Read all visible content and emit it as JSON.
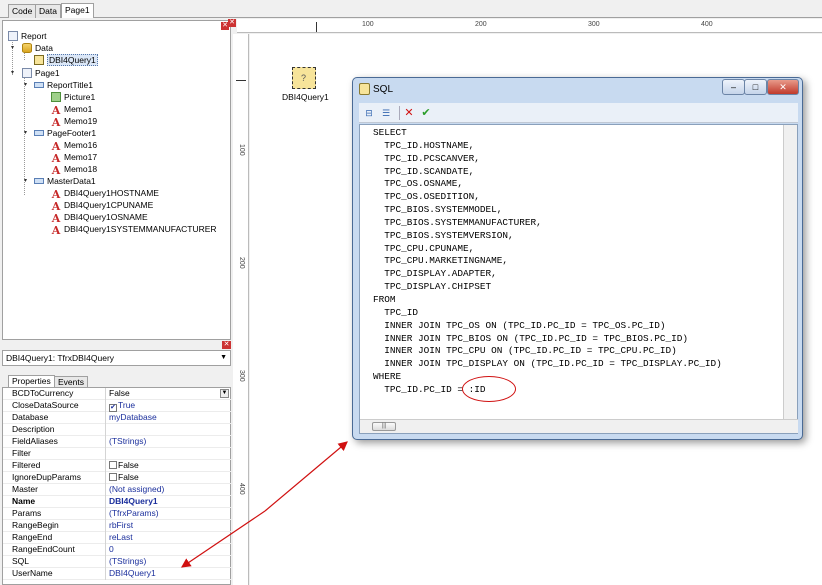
{
  "tabs": [
    "Code",
    "Data",
    "Page1"
  ],
  "tree": {
    "items": [
      {
        "label": "Report",
        "icon": "report-icon"
      },
      {
        "label": "Data",
        "icon": "database-icon"
      },
      {
        "label": "DBI4Query1",
        "icon": "query-icon"
      },
      {
        "label": "Page1",
        "icon": "page-icon"
      },
      {
        "label": "ReportTitle1",
        "icon": "band-icon"
      },
      {
        "label": "Picture1",
        "icon": "picture-icon"
      },
      {
        "label": "Memo1",
        "icon": "memo-icon"
      },
      {
        "label": "Memo19",
        "icon": "memo-icon"
      },
      {
        "label": "PageFooter1",
        "icon": "band-icon"
      },
      {
        "label": "Memo16",
        "icon": "memo-icon"
      },
      {
        "label": "Memo17",
        "icon": "memo-icon"
      },
      {
        "label": "Memo18",
        "icon": "memo-icon"
      },
      {
        "label": "MasterData1",
        "icon": "band-icon"
      },
      {
        "label": "DBI4Query1HOSTNAME",
        "icon": "memo-icon"
      },
      {
        "label": "DBI4Query1CPUNAME",
        "icon": "memo-icon"
      },
      {
        "label": "DBI4Query1OSNAME",
        "icon": "memo-icon"
      },
      {
        "label": "DBI4Query1SYSTEMMANUFACTURER",
        "icon": "memo-icon"
      }
    ]
  },
  "object_selector": "DBI4Query1: TfrxDBI4Query",
  "prop_tabs": [
    "Properties",
    "Events"
  ],
  "properties": [
    {
      "name": "BCDToCurrency",
      "value": "False"
    },
    {
      "name": "CloseDataSource",
      "value": "True"
    },
    {
      "name": "Database",
      "value": "myDatabase"
    },
    {
      "name": "Description",
      "value": ""
    },
    {
      "name": "FieldAliases",
      "value": "(TStrings)"
    },
    {
      "name": "Filter",
      "value": ""
    },
    {
      "name": "Filtered",
      "value": "False"
    },
    {
      "name": "IgnoreDupParams",
      "value": "False"
    },
    {
      "name": "Master",
      "value": "(Not assigned)"
    },
    {
      "name": "Name",
      "value": "DBI4Query1"
    },
    {
      "name": "Params",
      "value": "(TfrxParams)"
    },
    {
      "name": "RangeBegin",
      "value": "rbFirst"
    },
    {
      "name": "RangeEnd",
      "value": "reLast"
    },
    {
      "name": "RangeEndCount",
      "value": "0"
    },
    {
      "name": "SQL",
      "value": "(TStrings)"
    },
    {
      "name": "UserName",
      "value": "DBI4Query1"
    }
  ],
  "ruler": {
    "top": [
      "100",
      "200",
      "300",
      "400"
    ],
    "left": [
      "100",
      "200",
      "300",
      "400"
    ]
  },
  "designer": {
    "component_label": "DBI4Query1"
  },
  "dialog": {
    "title": "SQL",
    "minimize": "–",
    "maximize": "□",
    "close": "✕",
    "sql_lines": [
      "SELECT",
      "  TPC_ID.HOSTNAME,",
      "  TPC_ID.PCSCANVER,",
      "  TPC_ID.SCANDATE,",
      "  TPC_OS.OSNAME,",
      "  TPC_OS.OSEDITION,",
      "  TPC_BIOS.SYSTEMMODEL,",
      "  TPC_BIOS.SYSTEMMANUFACTURER,",
      "  TPC_BIOS.SYSTEMVERSION,",
      "  TPC_CPU.CPUNAME,",
      "  TPC_CPU.MARKETINGNAME,",
      "  TPC_DISPLAY.ADAPTER,",
      "  TPC_DISPLAY.CHIPSET",
      "FROM",
      "  TPC_ID",
      "  INNER JOIN TPC_OS ON (TPC_ID.PC_ID = TPC_OS.PC_ID)",
      "  INNER JOIN TPC_BIOS ON (TPC_ID.PC_ID = TPC_BIOS.PC_ID)",
      "  INNER JOIN TPC_CPU ON (TPC_ID.PC_ID = TPC_CPU.PC_ID)",
      "  INNER JOIN TPC_DISPLAY ON (TPC_ID.PC_ID = TPC_DISPLAY.PC_ID)",
      "WHERE",
      "  TPC_ID.PC_ID = :ID"
    ]
  },
  "colors": {
    "accent": "#1b2f9c",
    "annotation": "#d01010"
  }
}
